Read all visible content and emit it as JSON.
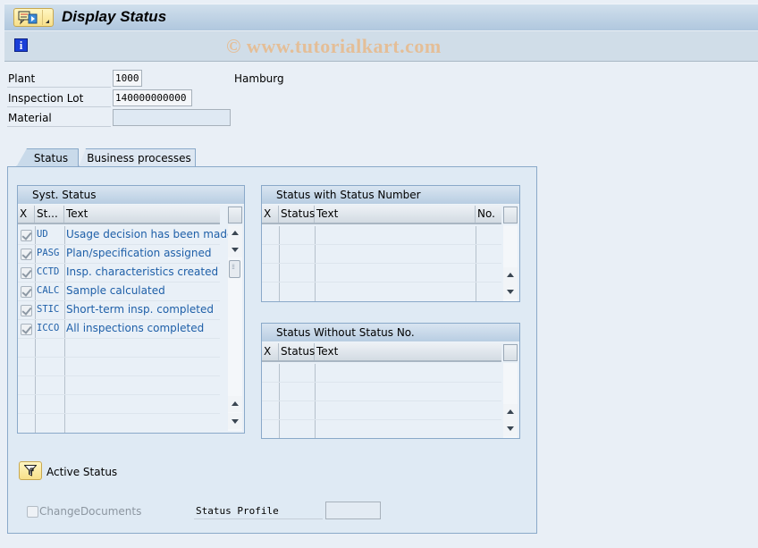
{
  "window": {
    "title": "Display Status",
    "watermark": "© www.tutorialkart.com"
  },
  "header_fields": {
    "plant": {
      "label": "Plant",
      "value": "1000",
      "description": "Hamburg"
    },
    "inspection_lot": {
      "label": "Inspection Lot",
      "value": "140000000000"
    },
    "material": {
      "label": "Material",
      "value": ""
    }
  },
  "tabs": [
    {
      "label": "Status",
      "active": true
    },
    {
      "label": "Business processes",
      "active": false
    }
  ],
  "syst_status": {
    "title": "Syst. Status",
    "columns": [
      "X",
      "St...",
      "Text"
    ],
    "rows": [
      {
        "checked": true,
        "code": "UD",
        "text": "Usage decision has been made"
      },
      {
        "checked": true,
        "code": "PASG",
        "text": "Plan/specification assigned"
      },
      {
        "checked": true,
        "code": "CCTD",
        "text": "Insp. characteristics created"
      },
      {
        "checked": true,
        "code": "CALC",
        "text": "Sample calculated"
      },
      {
        "checked": true,
        "code": "STIC",
        "text": "Short-term insp. completed"
      },
      {
        "checked": true,
        "code": "ICCO",
        "text": "All inspections completed"
      }
    ]
  },
  "status_with_number": {
    "title": "Status with Status Number",
    "columns": [
      "X",
      "Status",
      "Text",
      "No."
    ],
    "rows": []
  },
  "status_without_number": {
    "title": "Status Without Status No.",
    "columns": [
      "X",
      "Status",
      "Text"
    ],
    "rows": []
  },
  "footer": {
    "active_status_label": "Active Status",
    "change_documents_label": "ChangeDocuments",
    "change_documents_checked": false,
    "status_profile_label": "Status Profile",
    "status_profile_value": ""
  },
  "icons": {
    "menu": "menu-icon",
    "info": "info-icon",
    "active_status": "filter-funnel-icon"
  }
}
